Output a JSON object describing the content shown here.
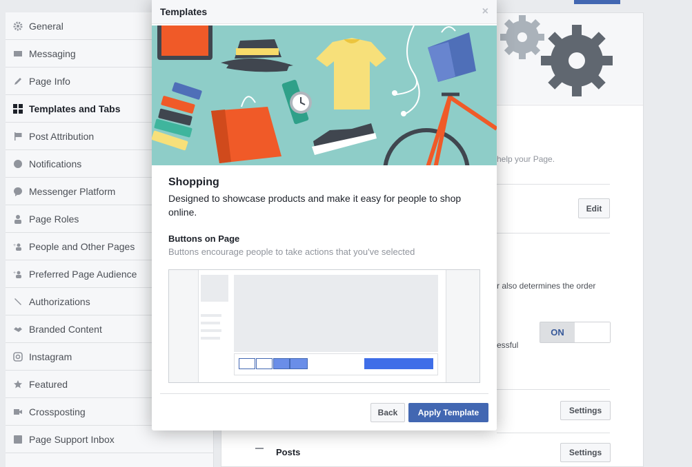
{
  "sidebar": {
    "items": [
      {
        "label": "General",
        "icon": "gear-icon"
      },
      {
        "label": "Messaging",
        "icon": "message-icon"
      },
      {
        "label": "Page Info",
        "icon": "pencil-icon"
      },
      {
        "label": "Templates and Tabs",
        "icon": "grid-icon"
      },
      {
        "label": "Post Attribution",
        "icon": "flag-icon"
      },
      {
        "label": "Notifications",
        "icon": "globe-icon"
      },
      {
        "label": "Messenger Platform",
        "icon": "messenger-icon"
      },
      {
        "label": "Page Roles",
        "icon": "person-icon"
      },
      {
        "label": "People and Other Pages",
        "icon": "people-icon"
      },
      {
        "label": "Preferred Page Audience",
        "icon": "people-icon"
      },
      {
        "label": "Authorizations",
        "icon": "wrench-icon"
      },
      {
        "label": "Branded Content",
        "icon": "handshake-icon"
      },
      {
        "label": "Instagram",
        "icon": "instagram-icon"
      },
      {
        "label": "Featured",
        "icon": "star-icon"
      },
      {
        "label": "Crossposting",
        "icon": "video-icon"
      },
      {
        "label": "Page Support Inbox",
        "icon": "facebook-icon"
      }
    ],
    "active": "Templates and Tabs"
  },
  "background": {
    "help_text": "help your Page.",
    "edit_label": "Edit",
    "order_text": "r also determines the order",
    "successful_text": "essful",
    "toggle_on": "ON",
    "settings_label": "Settings",
    "settings_label_2": "Settings",
    "posts_label": "Posts"
  },
  "modal": {
    "title": "Templates",
    "close": "×",
    "template_name": "Shopping",
    "template_desc": "Designed to showcase products and make it easy for people to shop online.",
    "section_title": "Buttons on Page",
    "section_desc": "Buttons encourage people to take actions that you've selected",
    "back_label": "Back",
    "apply_label": "Apply Template"
  },
  "colors": {
    "accent": "#4267b2",
    "hero_bg": "#8ecdc8",
    "orange": "#f05a28"
  }
}
